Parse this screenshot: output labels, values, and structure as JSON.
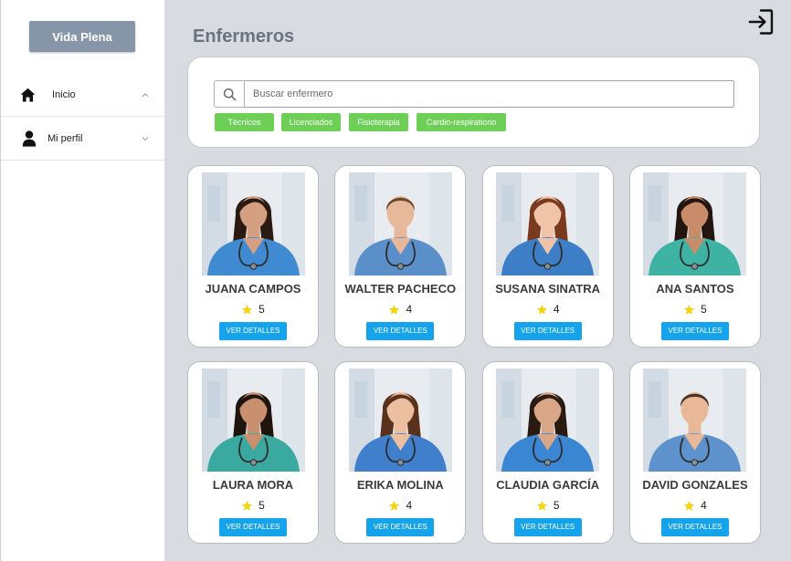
{
  "app": {
    "brand": "Vida Plena"
  },
  "colors": {
    "background": "#d8dbe0",
    "sidebar": "#ffffff",
    "brand": "#8795a8",
    "title": "#6b7280",
    "filter_tag": "#6dcf56",
    "accent": "#15a3ec",
    "star": "#f4d40b"
  },
  "sidebar": {
    "items": [
      {
        "label": "Inicio",
        "icon": "home-icon",
        "expand_icon": "chevron-up-icon"
      },
      {
        "label": "Mi perfil",
        "icon": "user-icon",
        "expand_icon": "chevron-down-icon"
      }
    ]
  },
  "header": {
    "title": "Enfermeros",
    "action_icon": "logout-icon"
  },
  "search": {
    "icon": "search-icon",
    "placeholder": "Buscar enfermero",
    "value": ""
  },
  "filters": [
    {
      "label": "Técnicos"
    },
    {
      "label": "Licenciados"
    },
    {
      "label": "Fisioterapia"
    },
    {
      "label": "Cardio-respiratiorio"
    }
  ],
  "cards": {
    "details_label": "VER DETALLES",
    "rating_icon": "star-icon"
  },
  "nurses": [
    {
      "name": "JUANA CAMPOS",
      "rating": 5,
      "avatar": "female-nurse",
      "photo": {
        "scrubs": "#3f8ad1",
        "hair": "#2b1a12",
        "skin": "#d4a081"
      }
    },
    {
      "name": "WALTER PACHECO",
      "rating": 4,
      "avatar": "male-nurse",
      "photo": {
        "scrubs": "#5a8fc9",
        "hair": "#6b4a2e",
        "skin": "#e8b89a"
      }
    },
    {
      "name": "SUSANA SINATRA",
      "rating": 4,
      "avatar": "female-nurse",
      "photo": {
        "scrubs": "#3d7fc7",
        "hair": "#7a3a1e",
        "skin": "#f0c4a8"
      }
    },
    {
      "name": "ANA SANTOS",
      "rating": 5,
      "avatar": "female-nurse",
      "photo": {
        "scrubs": "#3fb3a3",
        "hair": "#231510",
        "skin": "#c98c6a"
      }
    },
    {
      "name": "LAURA MORA",
      "rating": 5,
      "avatar": "female-nurse",
      "photo": {
        "scrubs": "#3aa9a0",
        "hair": "#1f140e",
        "skin": "#c8906e"
      }
    },
    {
      "name": "ERIKA MOLINA",
      "rating": 4,
      "avatar": "female-nurse",
      "photo": {
        "scrubs": "#3f7fcc",
        "hair": "#5a321c",
        "skin": "#ecbfa1"
      }
    },
    {
      "name": "CLAUDIA GARCÍA",
      "rating": 5,
      "avatar": "female-nurse",
      "photo": {
        "scrubs": "#3b86d3",
        "hair": "#2a1a12",
        "skin": "#d9a688"
      }
    },
    {
      "name": "DAVID GONZALES",
      "rating": 4,
      "avatar": "male-nurse",
      "photo": {
        "scrubs": "#5d92cc",
        "hair": "#4a3020",
        "skin": "#e9b898"
      }
    }
  ]
}
